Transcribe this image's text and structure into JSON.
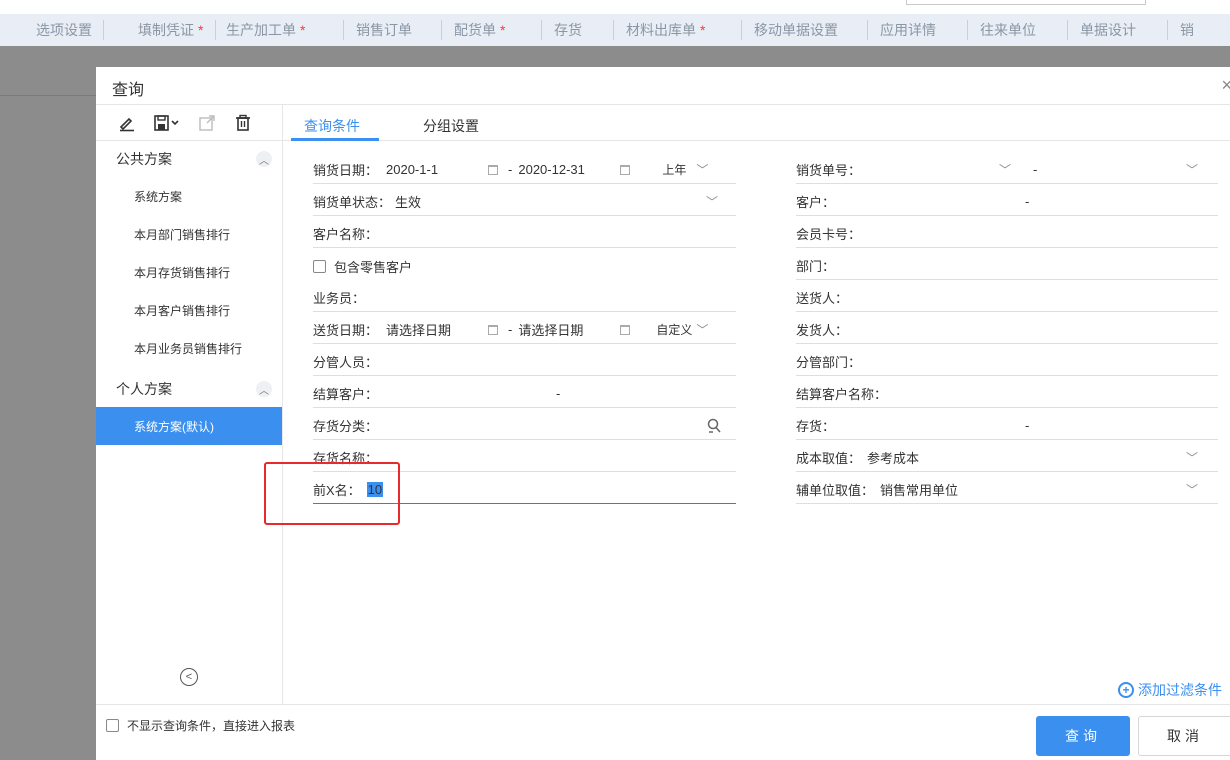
{
  "topbar": {
    "tabs": [
      {
        "label": "选项设置",
        "star": ""
      },
      {
        "label": "填制凭证",
        "star": "*"
      },
      {
        "label": "生产加工单",
        "star": "*"
      },
      {
        "label": "销售订单",
        "star": ""
      },
      {
        "label": "配货单",
        "star": "*"
      },
      {
        "label": "存货",
        "star": ""
      },
      {
        "label": "材料出库单",
        "star": "*"
      },
      {
        "label": "移动单据设置",
        "star": ""
      },
      {
        "label": "应用详情",
        "star": ""
      },
      {
        "label": "往来单位",
        "star": ""
      },
      {
        "label": "单据设计",
        "star": ""
      },
      {
        "label": "销",
        "star": ""
      }
    ]
  },
  "dialog": {
    "title": "查询",
    "close": "×"
  },
  "left": {
    "public_title": "公共方案",
    "public_items": [
      "系统方案",
      "本月部门销售排行",
      "本月存货销售排行",
      "本月客户销售排行",
      "本月业务员销售排行"
    ],
    "personal_title": "个人方案",
    "personal_items": [
      "系统方案(默认)"
    ]
  },
  "tabs": {
    "conditions": "查询条件",
    "grouping": "分组设置"
  },
  "form_left": {
    "sale_date": {
      "label": "销货日期：",
      "from": "2020-1-1",
      "to": "2020-12-31",
      "preset": "上年"
    },
    "status": {
      "label": "销货单状态：",
      "value": "生效"
    },
    "customer_name": {
      "label": "客户名称："
    },
    "include_retail": {
      "label": "包含零售客户"
    },
    "salesperson": {
      "label": "业务员："
    },
    "delivery_date": {
      "label": "送货日期：",
      "from_ph": "请选择日期",
      "to_ph": "请选择日期",
      "preset": "自定义"
    },
    "manager": {
      "label": "分管人员："
    },
    "settle_customer": {
      "label": "结算客户：",
      "value": "-"
    },
    "stock_category": {
      "label": "存货分类："
    },
    "stock_name": {
      "label": "存货名称："
    },
    "top_x": {
      "label": "前X名：",
      "value": "10"
    }
  },
  "form_right": {
    "sale_no": {
      "label": "销货单号：",
      "value": "-"
    },
    "customer": {
      "label": "客户：",
      "value": "-"
    },
    "member_card": {
      "label": "会员卡号："
    },
    "dept": {
      "label": "部门："
    },
    "deliverer": {
      "label": "送货人："
    },
    "shipper": {
      "label": "发货人："
    },
    "manage_dept": {
      "label": "分管部门："
    },
    "settle_customer_name": {
      "label": "结算客户名称："
    },
    "stock": {
      "label": "存货：",
      "value": "-"
    },
    "cost": {
      "label": "成本取值：",
      "value": "参考成本"
    },
    "aux_unit": {
      "label": "辅单位取值：",
      "value": "销售常用单位"
    }
  },
  "add_filter": "添加过滤条件",
  "footer": {
    "no_show": "不显示查询条件，直接进入报表",
    "query": "查询",
    "cancel": "取消"
  },
  "colors": {
    "accent": "#3b8fee",
    "highlight_box": "#e52b2b"
  }
}
